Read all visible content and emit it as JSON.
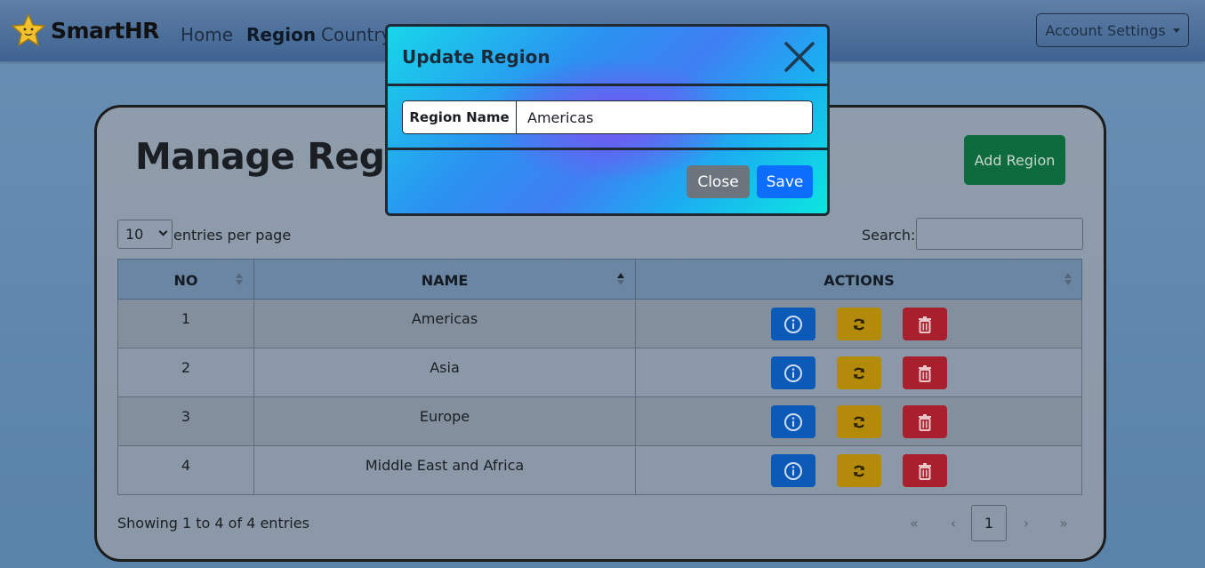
{
  "navbar": {
    "brand": "SmartHR",
    "links": [
      "Home",
      "Region",
      "Country"
    ],
    "active_link": "Region",
    "account_button": "Account Settings"
  },
  "page": {
    "title": "Manage Region",
    "add_button": "Add Region",
    "entries_per_page_value": "10",
    "entries_per_page_label": "entries per page",
    "search_label": "Search:",
    "search_value": ""
  },
  "table": {
    "columns": [
      "NO",
      "NAME",
      "ACTIONS"
    ],
    "sorted_column": "NAME",
    "rows": [
      {
        "no": "1",
        "name": "Americas"
      },
      {
        "no": "2",
        "name": "Asia"
      },
      {
        "no": "3",
        "name": "Europe"
      },
      {
        "no": "4",
        "name": "Middle East and Africa"
      }
    ],
    "action_icons": [
      "info-icon",
      "refresh-icon",
      "trash-icon"
    ],
    "action_colors": {
      "info": "#0b5ab8",
      "update": "#b48a0a",
      "delete": "#a8202d"
    }
  },
  "footer": {
    "showing": "Showing 1 to 4 of 4 entries",
    "pager": {
      "first": "«",
      "prev": "‹",
      "current": "1",
      "next": "›",
      "last": "»"
    }
  },
  "modal": {
    "title": "Update Region",
    "field_label": "Region Name",
    "field_value": "Americas",
    "close_button": "Close",
    "save_button": "Save"
  }
}
